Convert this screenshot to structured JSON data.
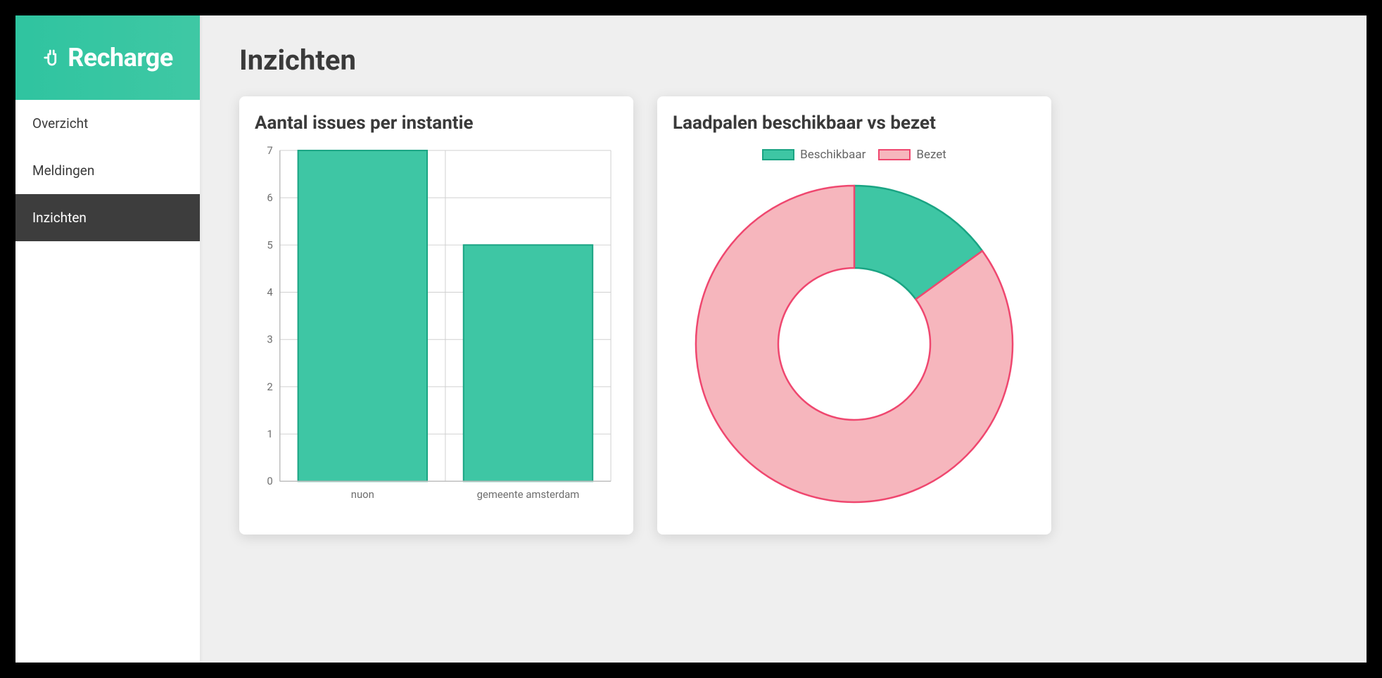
{
  "brand": {
    "name": "Recharge"
  },
  "sidebar": {
    "items": [
      {
        "label": "Overzicht",
        "active": false
      },
      {
        "label": "Meldingen",
        "active": false
      },
      {
        "label": "Inzichten",
        "active": true
      }
    ]
  },
  "page": {
    "title": "Inzichten"
  },
  "cards": {
    "bar": {
      "title": "Aantal issues per instantie"
    },
    "donut": {
      "title": "Laadpalen beschikbaar vs bezet"
    }
  },
  "colors": {
    "teal_fill": "#3ec6a4",
    "teal_stroke": "#1aa483",
    "pink_fill": "#f6b6bd",
    "pink_stroke": "#ef476f",
    "grid": "#d0d0d0",
    "axis_text": "#6e6e6e"
  },
  "chart_data": [
    {
      "type": "bar",
      "title": "Aantal issues per instantie",
      "categories": [
        "nuon",
        "gemeente amsterdam"
      ],
      "values": [
        7,
        5
      ],
      "ylabel": "",
      "xlabel": "",
      "ylim": [
        0,
        7
      ],
      "yticks": [
        0,
        1,
        2,
        3,
        4,
        5,
        6,
        7
      ]
    },
    {
      "type": "pie",
      "title": "Laadpalen beschikbaar vs bezet",
      "series": [
        {
          "name": "Beschikbaar",
          "value": 15
        },
        {
          "name": "Bezet",
          "value": 85
        }
      ],
      "legend_position": "top"
    }
  ]
}
